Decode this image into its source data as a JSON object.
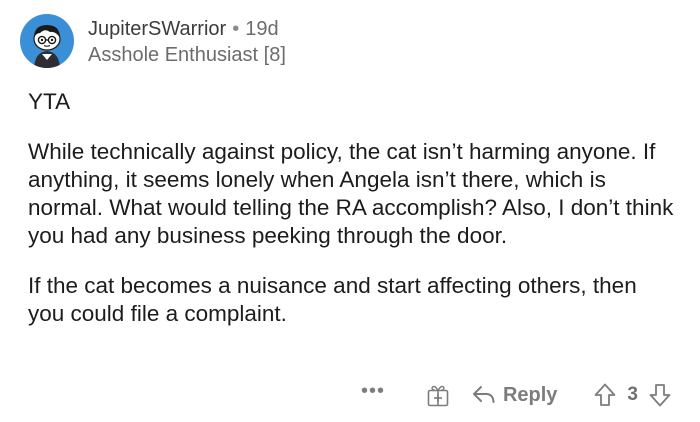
{
  "comment": {
    "username": "JupiterSWarrior",
    "separator": "•",
    "age": "19d",
    "flair": "Asshole Enthusiast [8]",
    "paragraphs": [
      "YTA",
      "While technically against policy, the cat isn’t harming anyone. If anything, it seems lonely when Angela isn’t there, which is normal. What would telling the RA accomplish? Also, I don’t think you had any business peeking through the door.",
      "If the cat becomes a nuisance and start affecting others, then you could file a complaint."
    ]
  },
  "actions": {
    "more": "•••",
    "reply_label": "Reply",
    "vote_count": "3"
  },
  "icons": {
    "avatar": "snoo-avatar",
    "award": "award-gift-icon",
    "reply": "reply-arrow-icon",
    "upvote": "upvote-arrow-icon",
    "downvote": "downvote-arrow-icon"
  },
  "colors": {
    "avatar_bg": "#3b8fd6",
    "text": "#1c1c1d",
    "muted": "#7c7c7e"
  }
}
